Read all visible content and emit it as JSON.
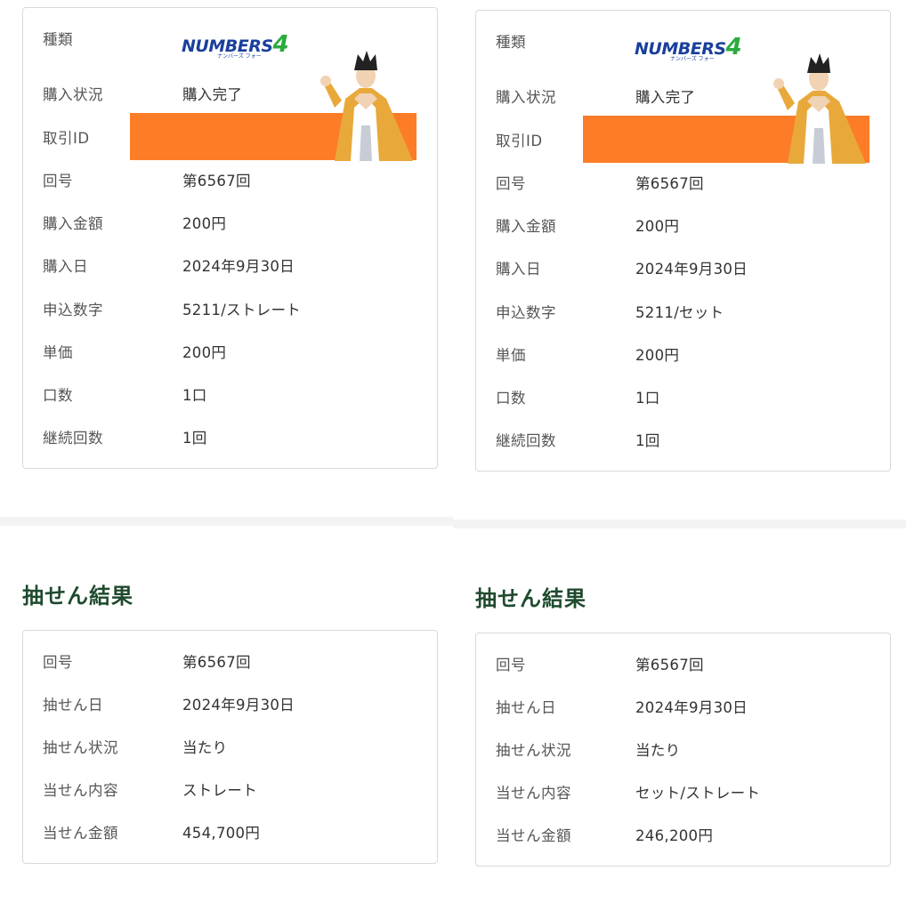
{
  "labels": {
    "type": "種類",
    "status": "購入状況",
    "tx_id": "取引ID",
    "round": "回号",
    "amount": "購入金額",
    "date": "購入日",
    "numbers": "申込数字",
    "unit_price": "単価",
    "units": "口数",
    "continue": "継続回数",
    "draw_round": "回号",
    "draw_date": "抽せん日",
    "draw_status": "抽せん状況",
    "win_content": "当せん内容",
    "win_amount": "当せん金額"
  },
  "logo": {
    "text": "NUMBERS",
    "digit": "4",
    "kana": "ナンバーズ フォー"
  },
  "section_title": "抽せん結果",
  "left": {
    "purchase": {
      "status": "購入完了",
      "round": "第6567回",
      "amount": "200円",
      "date": "2024年9月30日",
      "numbers": "5211/ストレート",
      "unit_price": "200円",
      "units": "1口",
      "continue": "1回"
    },
    "result": {
      "round": "第6567回",
      "date": "2024年9月30日",
      "status": "当たり",
      "content": "ストレート",
      "amount": "454,700円"
    }
  },
  "right": {
    "purchase": {
      "status": "購入完了",
      "round": "第6567回",
      "amount": "200円",
      "date": "2024年9月30日",
      "numbers": "5211/セット",
      "unit_price": "200円",
      "units": "1口",
      "continue": "1回"
    },
    "result": {
      "round": "第6567回",
      "date": "2024年9月30日",
      "status": "当たり",
      "content": "セット/ストレート",
      "amount": "246,200円"
    }
  },
  "colors": {
    "redaction": "#fd7c28",
    "title": "#1f4a2e",
    "logo_blue": "#1a3f9c",
    "logo_green": "#2bab3f"
  }
}
